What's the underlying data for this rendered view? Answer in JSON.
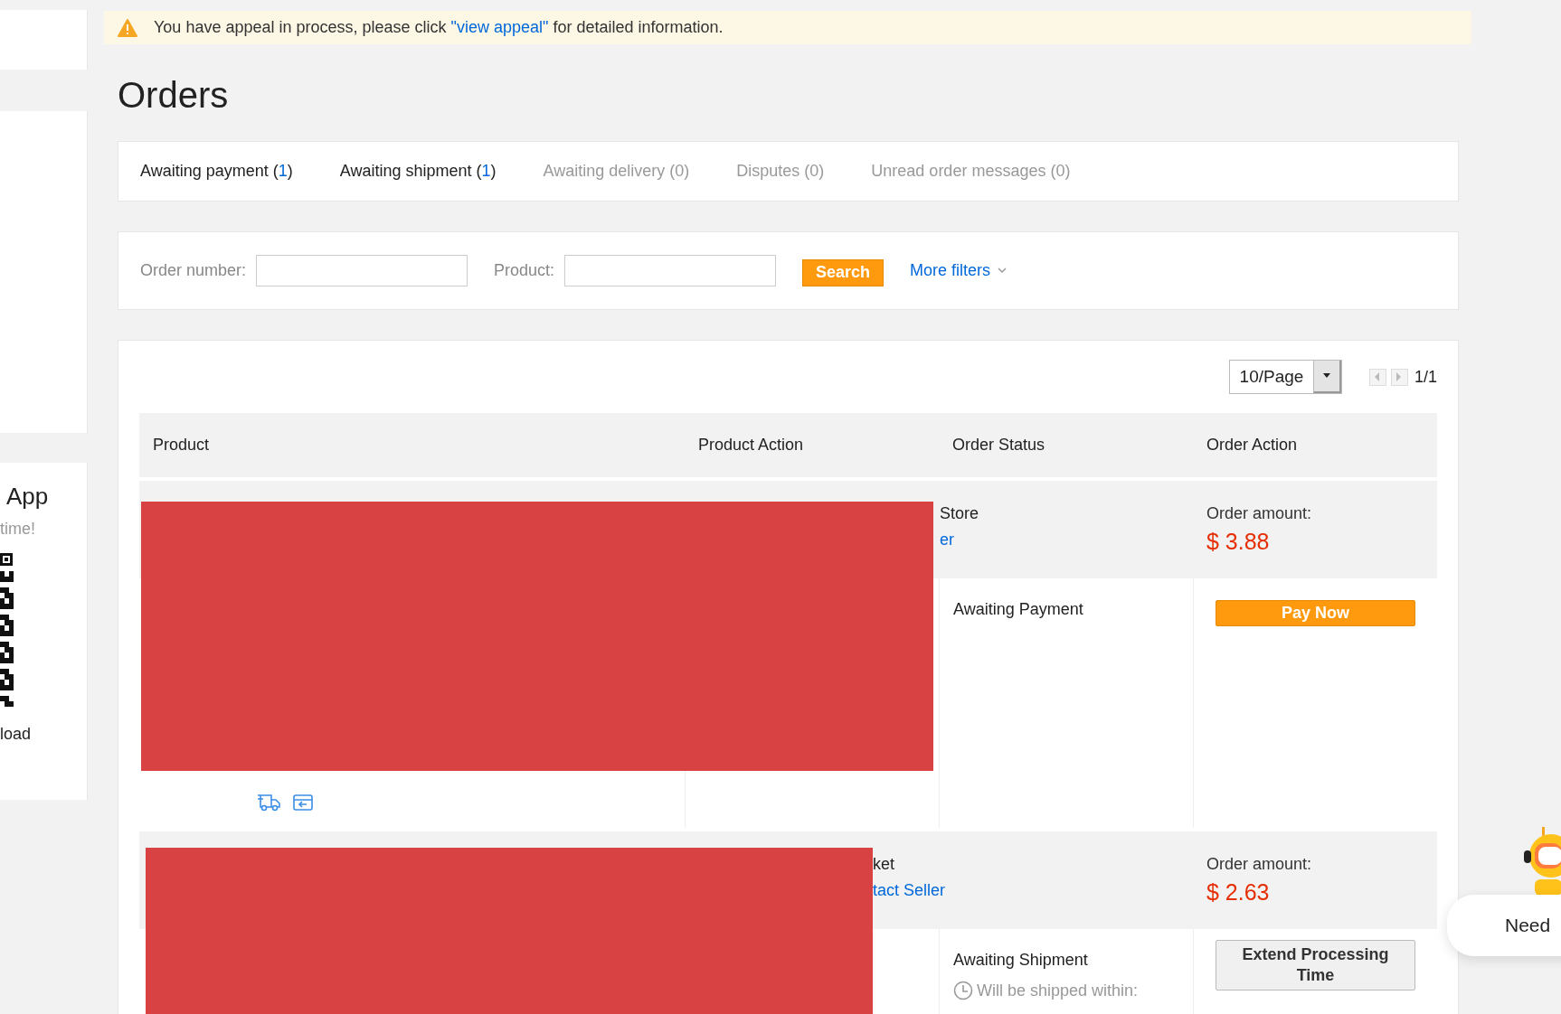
{
  "sidebar": {
    "app_card": {
      "title": "App",
      "subtitle": "time!",
      "link": "load"
    }
  },
  "notice": {
    "text_before": "You have appeal in process, please click ",
    "link": "\"view appeal\"",
    "text_after": " for detailed information."
  },
  "page_title": "Orders",
  "tabs": [
    {
      "label": "Awaiting payment (",
      "count": "1",
      "close": ")",
      "disabled": false
    },
    {
      "label": "Awaiting shipment (",
      "count": "1",
      "close": ")",
      "disabled": false
    },
    {
      "label": "Awaiting delivery (",
      "count": "0",
      "close": ")",
      "disabled": true
    },
    {
      "label": "Disputes (",
      "count": "0",
      "close": ")",
      "disabled": true
    },
    {
      "label": "Unread order messages (",
      "count": "0",
      "close": ")",
      "disabled": true
    }
  ],
  "filters": {
    "order_number_label": "Order number:",
    "product_label": "Product:",
    "search_button": "Search",
    "more_filters": "More filters"
  },
  "pagination": {
    "per_page": "10/Page",
    "page": "1/1"
  },
  "table": {
    "columns": [
      "Product",
      "Product Action",
      "Order Status",
      "Order Action"
    ]
  },
  "orders": [
    {
      "seller_name": "Store",
      "seller_link": "er",
      "amount_label": "Order amount:",
      "amount": "$ 3.88",
      "status": "Awaiting Payment",
      "action": {
        "kind": "primary",
        "label": "Pay Now"
      },
      "product_icons": true,
      "redacted": true
    },
    {
      "seller_name": "ket",
      "seller_link": "tact Seller",
      "amount_label": "Order amount:",
      "amount": "$ 2.63",
      "status": "Awaiting Shipment",
      "note": "Will be shipped within:",
      "action": {
        "kind": "secondary",
        "label": "Extend Processing Time"
      },
      "product_icons": false,
      "redacted": true
    }
  ],
  "help_widget": {
    "label": "Need"
  }
}
